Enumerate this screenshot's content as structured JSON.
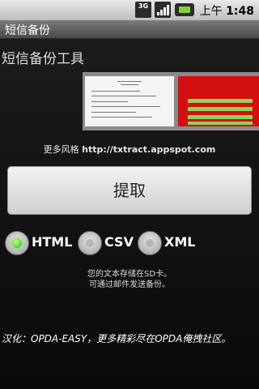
{
  "status_bar": {
    "network_label": "3G",
    "time_prefix": "上午",
    "time": "1:48"
  },
  "title_bar": {
    "title": "短信备份"
  },
  "main": {
    "heading": "短信备份工具",
    "more_styles_label": "更多风格",
    "more_styles_url": "http://txtract.appspot.com",
    "fetch_button_label": "提取",
    "formats": [
      {
        "label": "HTML",
        "selected": true
      },
      {
        "label": "CSV",
        "selected": false
      },
      {
        "label": "XML",
        "selected": false
      }
    ],
    "info_line1": "您的文本存储在SD卡。",
    "info_line2": "可通过邮件发送备份。",
    "credit": "汉化：OPDA-EASY，更多精彩尽在OPDA俺拽社区。"
  },
  "colors": {
    "selected_radio": "#2fbf0e",
    "preview_red": "#d40f0f",
    "preview_green": "#8fd35a"
  }
}
